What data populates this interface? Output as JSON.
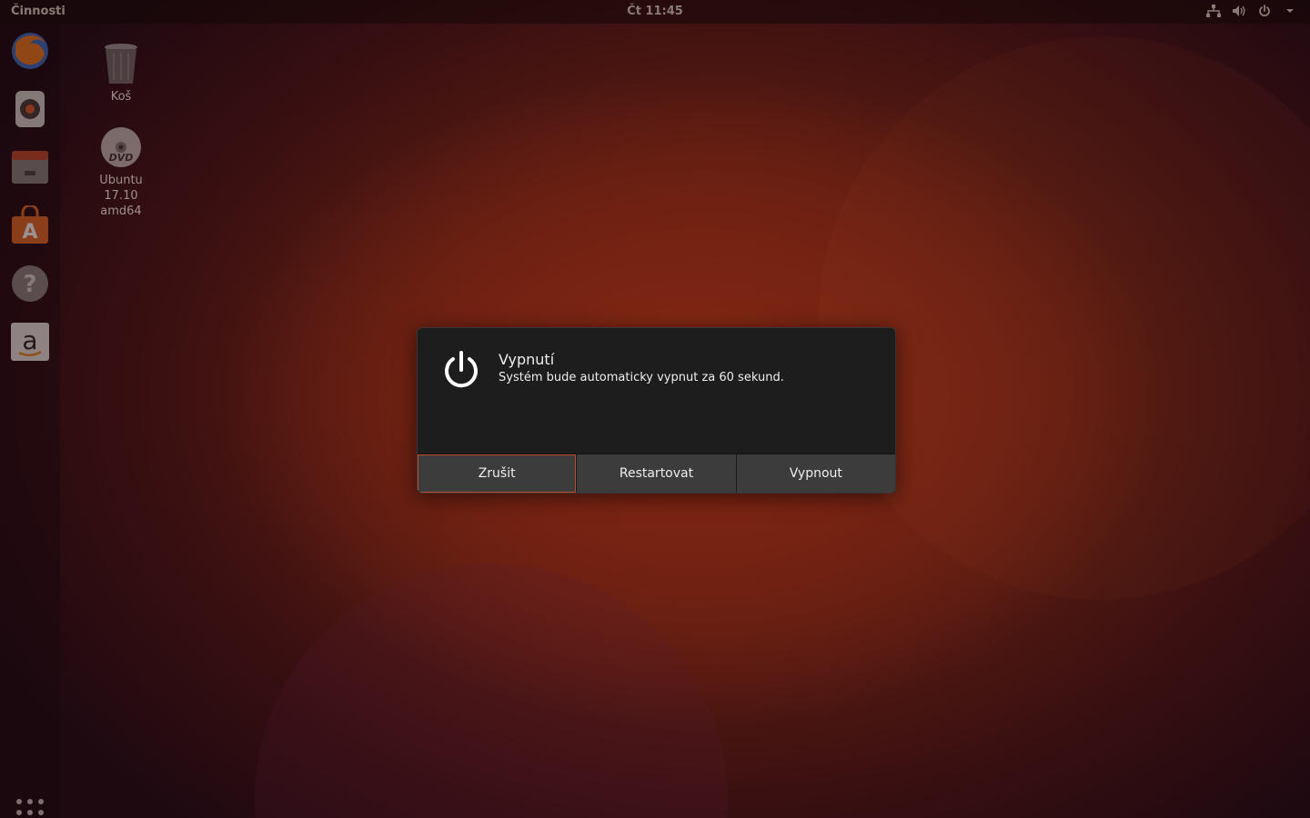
{
  "topbar": {
    "activities_label": "Činnosti",
    "clock": "Čt 11:45",
    "tray_icons": [
      "network-icon",
      "volume-icon",
      "power-icon",
      "chevron-down-icon"
    ]
  },
  "dock": {
    "items": [
      {
        "name": "firefox",
        "icon": "firefox-icon"
      },
      {
        "name": "rhythmbox",
        "icon": "speaker-icon"
      },
      {
        "name": "files",
        "icon": "file-cabinet-icon"
      },
      {
        "name": "software",
        "icon": "shopping-bag-icon",
        "glyph": "A"
      },
      {
        "name": "help",
        "icon": "help-icon",
        "glyph": "?"
      },
      {
        "name": "amazon",
        "icon": "amazon-icon",
        "glyph": "a"
      }
    ],
    "app_grid_icon": "app-grid-icon"
  },
  "desktop": {
    "icons": [
      {
        "label": "Koš",
        "icon": "trash-icon"
      },
      {
        "label_lines": [
          "Ubuntu",
          "17.10",
          "amd64"
        ],
        "icon": "dvd-icon",
        "dvd_text": "DVD"
      }
    ]
  },
  "dialog": {
    "icon": "power-icon",
    "title": "Vypnutí",
    "message": "Systém bude automaticky vypnut za 60 sekund.",
    "buttons": [
      {
        "label": "Zrušit",
        "focused": true
      },
      {
        "label": "Restartovat",
        "focused": false
      },
      {
        "label": "Vypnout",
        "focused": false
      }
    ]
  },
  "colors": {
    "accent": "#c24d2c",
    "dialog_bg": "#1d1d1d",
    "button_bg": "#3c3c3c",
    "text": "#eeeeec"
  }
}
